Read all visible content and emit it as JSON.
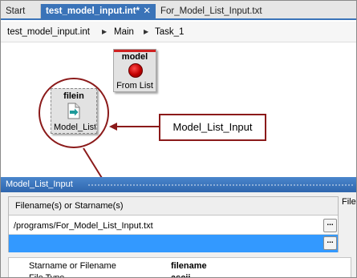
{
  "tabs": [
    {
      "label": "Start"
    },
    {
      "label": "test_model_input.int*",
      "close": "✕"
    },
    {
      "label": "For_Model_List_Input.txt"
    }
  ],
  "breadcrumb": [
    "test_model_input.int",
    "Main",
    "Task_1"
  ],
  "canvas": {
    "model_node": {
      "title": "model",
      "subtitle": "From List"
    },
    "filein_node": {
      "title": "filein",
      "subtitle": "Model_List_Input"
    },
    "callout": "Model_List_Input"
  },
  "panel": {
    "title": "Model_List_Input",
    "column_header": "Filename(s) or Starname(s)",
    "rows": [
      "/programs/For_Model_List_Input.txt",
      ""
    ],
    "browse_label": "...",
    "side_label": "Filein",
    "properties": [
      {
        "key": "Starname or Filename",
        "value": "filename"
      },
      {
        "key": "File Type",
        "value": "ascii"
      }
    ]
  },
  "colors": {
    "accent": "#3a73b8",
    "selection": "#3399ff",
    "callout": "#8b1a1a",
    "model_red": "#d02020"
  }
}
